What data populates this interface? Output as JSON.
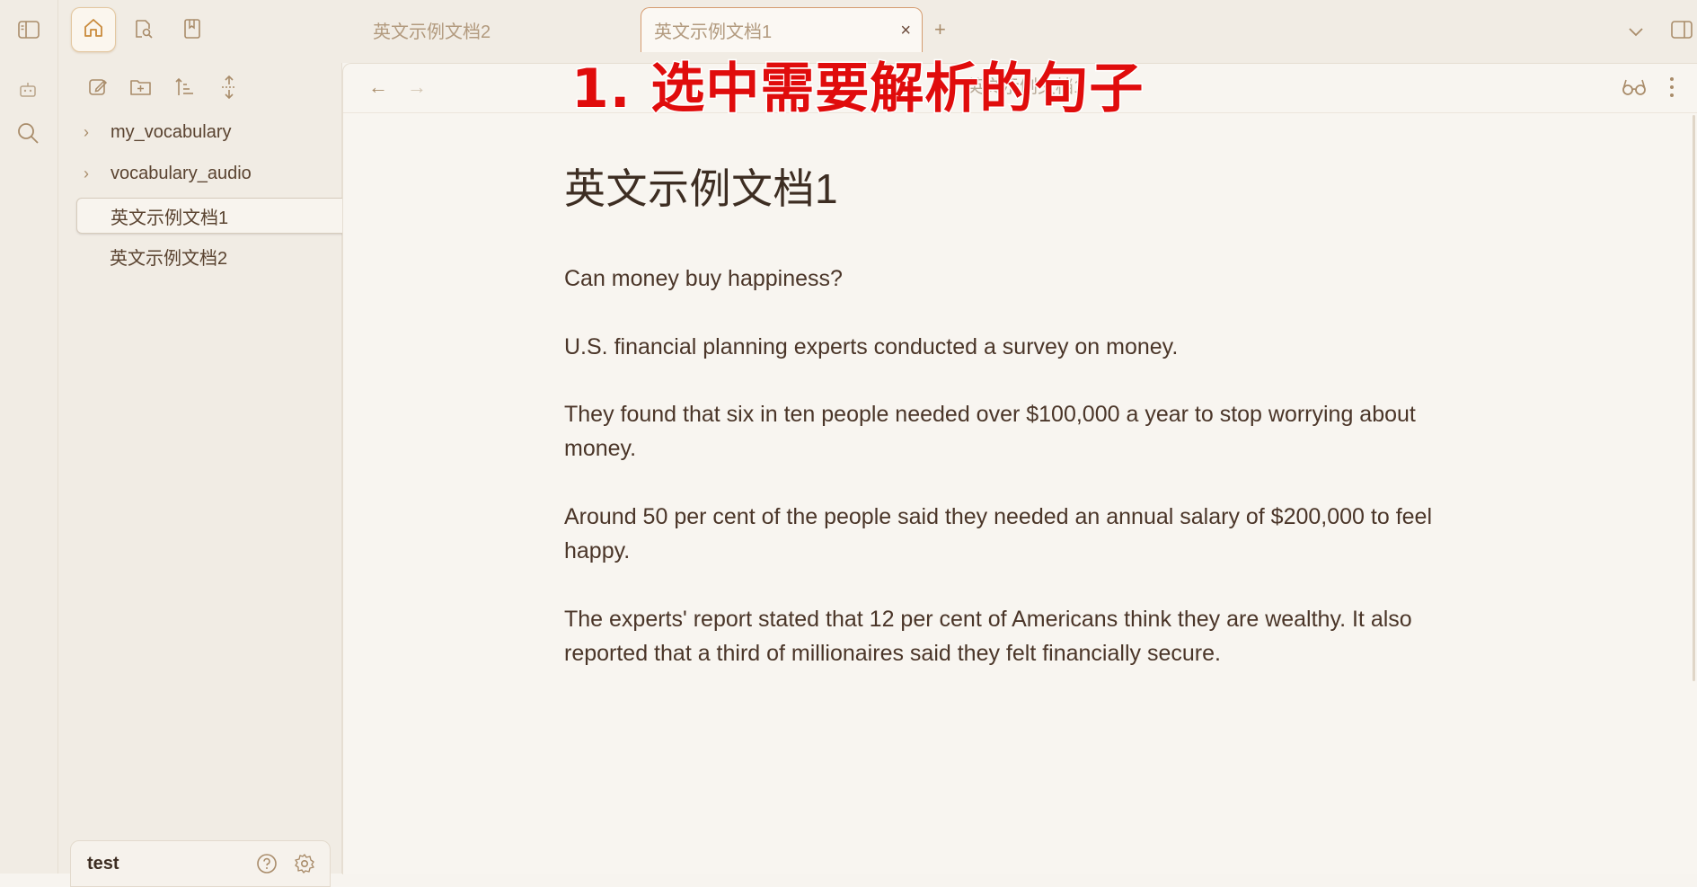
{
  "tabs": {
    "inactive_label": "英文示例文档2",
    "active_label": "英文示例文档1",
    "close_glyph": "×",
    "new_tab_glyph": "+"
  },
  "nav": {
    "back_glyph": "←",
    "forward_glyph": "→",
    "breadcrumb_title": "英文示例文档1"
  },
  "file_tree": {
    "folders": [
      {
        "label": "my_vocabulary"
      },
      {
        "label": "vocabulary_audio"
      }
    ],
    "files": [
      {
        "label": "英文示例文档1",
        "selected": true
      },
      {
        "label": "英文示例文档2",
        "selected": false
      }
    ]
  },
  "document": {
    "title": "英文示例文档1",
    "paragraphs": [
      "Can money buy happiness?",
      "U.S. financial planning experts conducted a survey on money.",
      "They found that six in ten people needed over $100,000 a year to stop worrying about money.",
      "Around 50 per cent of the people said they needed an annual salary of $200,000 to feel happy.",
      "The experts' report stated that 12 per cent of Americans think they are wealthy. It also reported that a third of millionaires said they felt financially secure."
    ]
  },
  "annotation": "1. 选中需要解析的句子",
  "vault": {
    "name": "test"
  },
  "icons": {
    "ribbon": [
      "sidebar-toggle-icon",
      "robot-icon",
      "search-icon"
    ],
    "header": [
      "home-icon",
      "file-search-icon",
      "bookmark-icon"
    ],
    "tree_toolbar": [
      "new-note-icon",
      "new-folder-icon",
      "sort-icon",
      "collapse-icon"
    ],
    "right": [
      "tab-list-chevron-icon",
      "right-sidebar-toggle-icon",
      "reading-view-icon",
      "more-options-icon"
    ],
    "vault": [
      "help-icon",
      "settings-icon"
    ]
  },
  "colors": {
    "accent": "#c98a3b",
    "annotation": "#e00c0c",
    "background": "#f8f5f0"
  }
}
